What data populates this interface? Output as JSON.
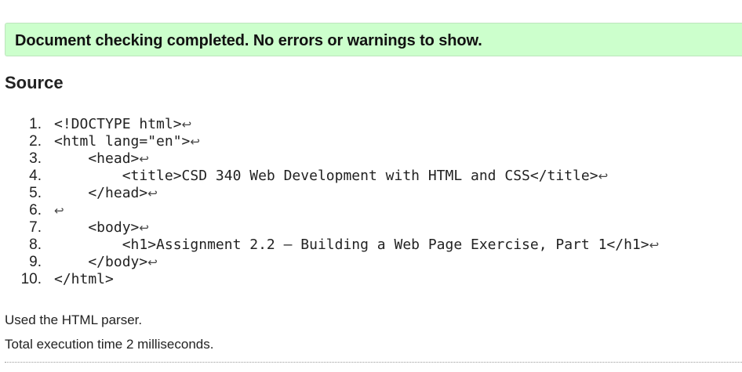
{
  "banner": {
    "message": "Document checking completed. No errors or warnings to show."
  },
  "source": {
    "heading": "Source",
    "line_end_glyph": "↩",
    "lines": [
      {
        "num": "1.",
        "code": "<!DOCTYPE html>",
        "lf": true
      },
      {
        "num": "2.",
        "code": "<html lang=\"en\">",
        "lf": true
      },
      {
        "num": "3.",
        "code": "    <head>",
        "lf": true
      },
      {
        "num": "4.",
        "code": "        <title>CSD 340 Web Development with HTML and CSS</title>",
        "lf": true
      },
      {
        "num": "5.",
        "code": "    </head>",
        "lf": true
      },
      {
        "num": "6.",
        "code": "",
        "lf": true
      },
      {
        "num": "7.",
        "code": "    <body>",
        "lf": true
      },
      {
        "num": "8.",
        "code": "        <h1>Assignment 2.2 – Building a Web Page Exercise, Part 1</h1>",
        "lf": true
      },
      {
        "num": "9.",
        "code": "    </body>",
        "lf": true
      },
      {
        "num": "10.",
        "code": "</html>",
        "lf": false
      }
    ]
  },
  "info": {
    "parser": "Used the HTML parser.",
    "time": "Total execution time 2 milliseconds."
  },
  "colors": {
    "success_bg": "#ccffcc",
    "success_border": "#bde5bd"
  }
}
